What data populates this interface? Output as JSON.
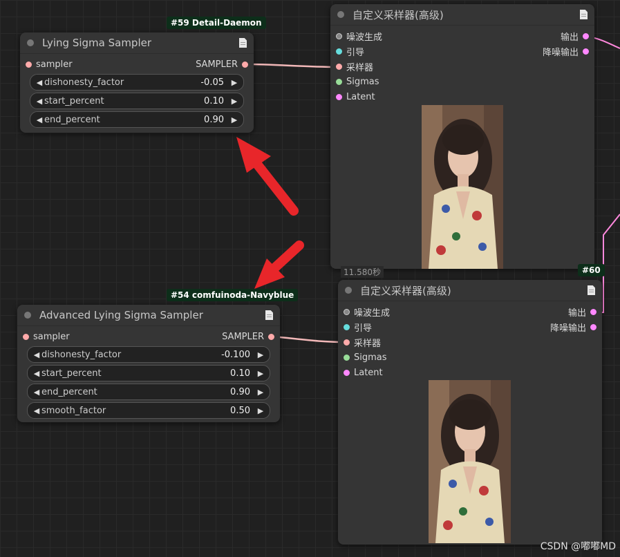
{
  "node59": {
    "badge": "#59 Detail-Daemon",
    "title": "Lying Sigma Sampler",
    "input_label": "sampler",
    "output_label": "SAMPLER",
    "widgets": [
      {
        "label": "dishonesty_factor",
        "value": "-0.05"
      },
      {
        "label": "start_percent",
        "value": "0.10"
      },
      {
        "label": "end_percent",
        "value": "0.90"
      }
    ]
  },
  "node54": {
    "badge": "#54 comfuinoda-Navyblue",
    "title": "Advanced Lying Sigma Sampler",
    "input_label": "sampler",
    "output_label": "SAMPLER",
    "widgets": [
      {
        "label": "dishonesty_factor",
        "value": "-0.100"
      },
      {
        "label": "start_percent",
        "value": "0.10"
      },
      {
        "label": "end_percent",
        "value": "0.90"
      },
      {
        "label": "smooth_factor",
        "value": "0.50"
      }
    ]
  },
  "sampler_top": {
    "title": "自定义采样器(高级)",
    "inputs": [
      "噪波生成",
      "引导",
      "采样器",
      "Sigmas",
      "Latent"
    ],
    "outputs": [
      "输出",
      "降噪输出"
    ],
    "timer": "11.580秒"
  },
  "sampler_bottom": {
    "title": "自定义采样器(高级)",
    "badge": "#60",
    "inputs": [
      "噪波生成",
      "引导",
      "采样器",
      "Sigmas",
      "Latent"
    ],
    "outputs": [
      "输出",
      "降噪输出"
    ]
  },
  "watermark": "CSDN @嘟嘟MD",
  "colors": {
    "noise": "#aaaaaa",
    "guider": "#66dddd",
    "sampler": "#ffaaaa",
    "sigmas": "#99dd99",
    "latent": "#ff88ff",
    "link_sampler": "#f2b8b8",
    "link_latent": "#ff88dd",
    "arrow": "#e8262a"
  }
}
